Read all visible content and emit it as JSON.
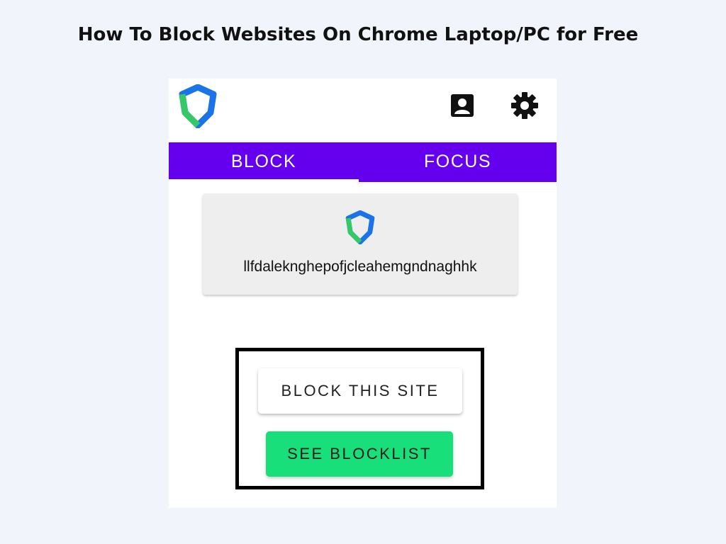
{
  "headline": "How To Block Websites On Chrome Laptop/PC for Free",
  "header": {
    "logo_icon": "shield-logo-icon",
    "profile_icon": "account-box-icon",
    "settings_icon": "gear-icon"
  },
  "tabs": [
    {
      "label": "BLOCK",
      "active": true
    },
    {
      "label": "FOCUS",
      "active": false
    }
  ],
  "site_card": {
    "icon": "shield-logo-icon",
    "extension_id": "llfdaleknghepofjcleahemgndnaghhk"
  },
  "actions": {
    "block_this_site_label": "BLOCK THIS SITE",
    "see_blocklist_label": "SEE BLOCKLIST"
  },
  "colors": {
    "page_background": "#f2f4fb",
    "tab_bar": "#6400ee",
    "blocklist_button": "#19df7a",
    "logo_blue": "#1a73e8",
    "logo_green": "#34c866",
    "highlight_border": "#000000"
  }
}
